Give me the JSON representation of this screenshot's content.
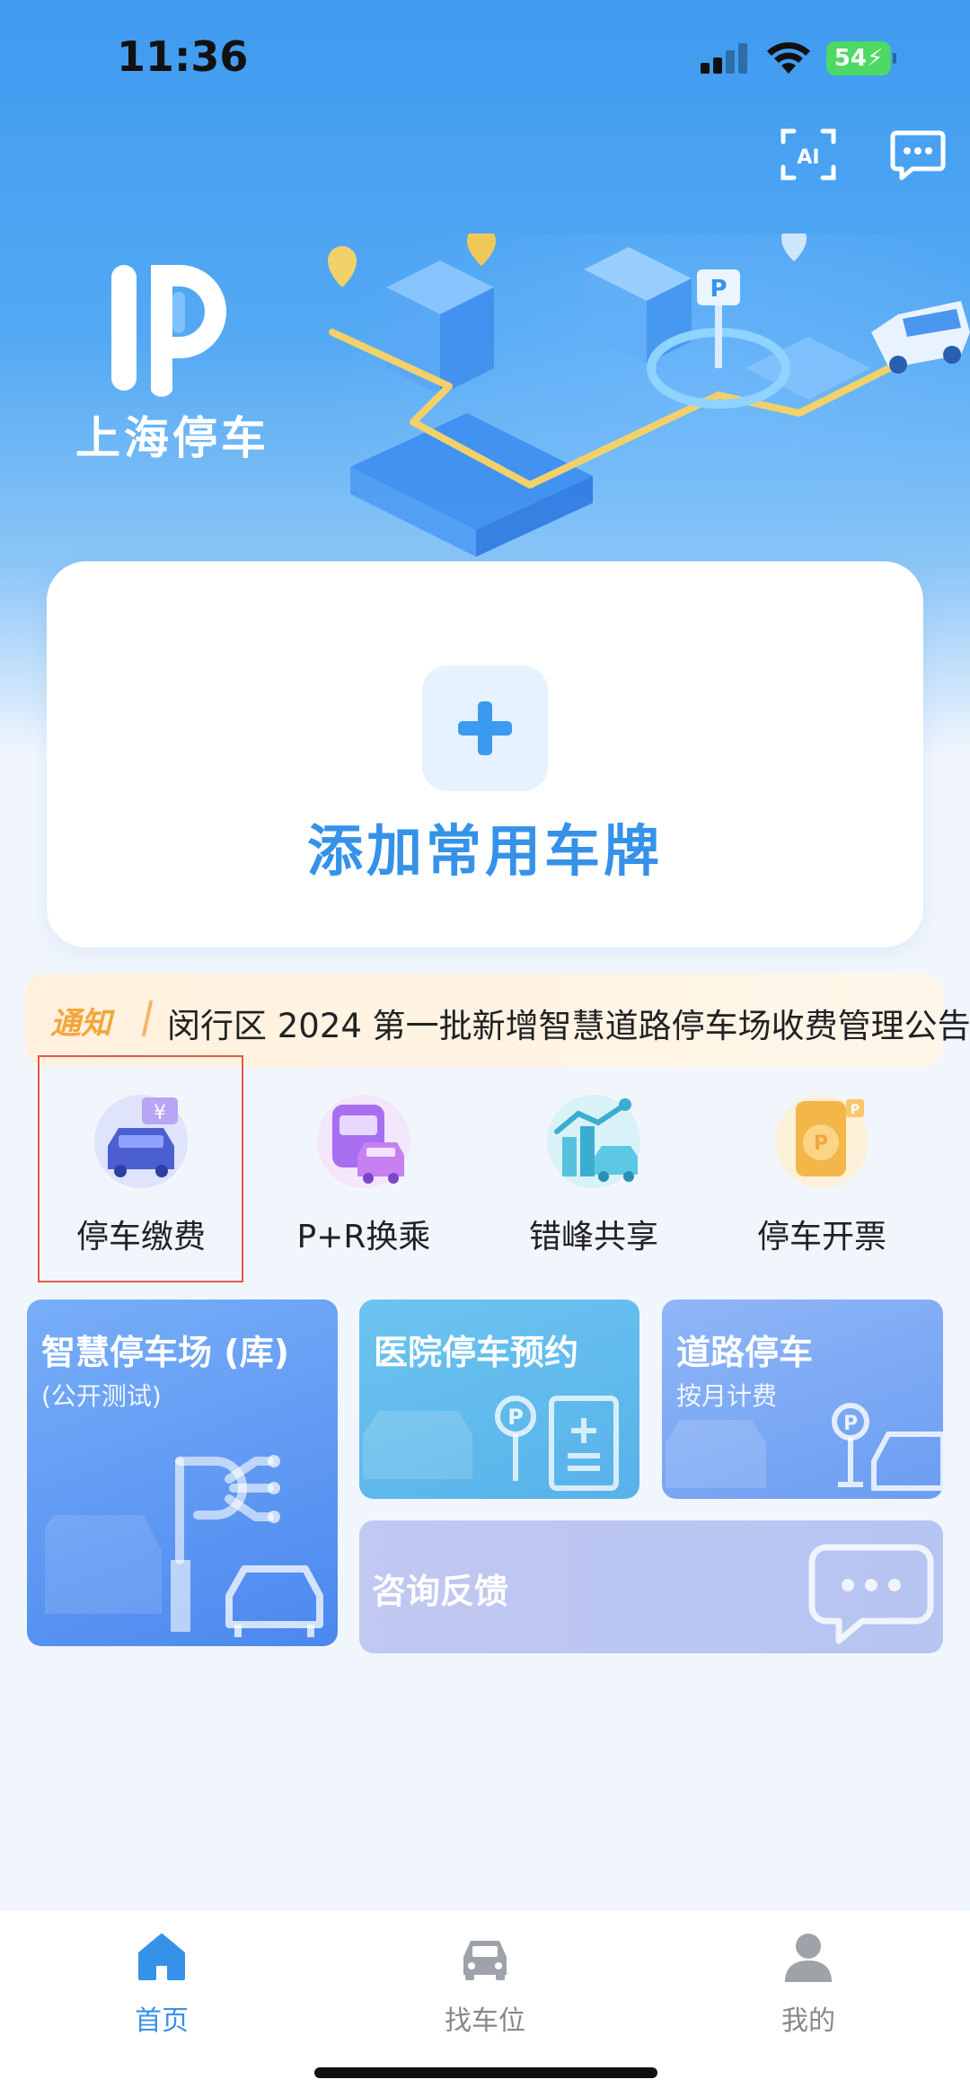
{
  "status": {
    "time": "11:36",
    "battery": "54"
  },
  "header": {
    "ai_icon": "ai-scan-icon",
    "message_icon": "message-icon",
    "brand": "上海停车"
  },
  "add_plate": {
    "label": "添加常用车牌",
    "icon": "plus-icon"
  },
  "notice": {
    "tag": "通知",
    "text": "闵行区 2024 第一批新增智慧道路停车场收费管理公告"
  },
  "quick_actions": [
    {
      "label": "停车缴费",
      "icon": "parking-payment-icon"
    },
    {
      "label": "P+R换乘",
      "icon": "park-and-ride-icon"
    },
    {
      "label": "错峰共享",
      "icon": "off-peak-share-icon"
    },
    {
      "label": "停车开票",
      "icon": "parking-invoice-icon"
    }
  ],
  "tiles": {
    "smart_lot": {
      "title": "智慧停车场 (库)",
      "subtitle": "(公开测试)"
    },
    "hospital": {
      "title": "医院停车预约"
    },
    "road": {
      "title": "道路停车",
      "subtitle": "按月计费"
    },
    "feedback": {
      "title": "咨询反馈"
    }
  },
  "nav": [
    {
      "label": "首页",
      "icon": "home-icon",
      "active": true
    },
    {
      "label": "找车位",
      "icon": "car-icon",
      "active": false
    },
    {
      "label": "我的",
      "icon": "user-icon",
      "active": false
    }
  ],
  "colors": {
    "accent": "#3592e8",
    "hero_blue": "#3f9bf0",
    "notice_orange": "#f3a53b",
    "highlight_red": "#e05a48"
  }
}
